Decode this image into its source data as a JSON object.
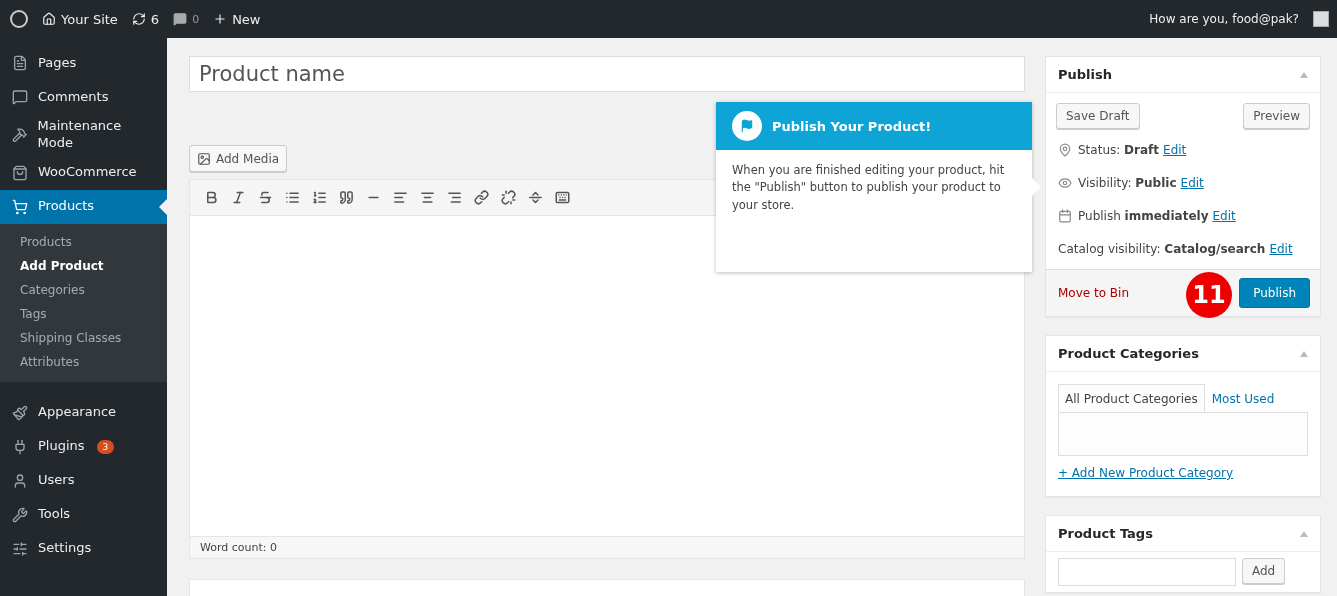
{
  "admin_bar": {
    "site_name": "Your Site",
    "updates_count": "6",
    "comments_count": "0",
    "new_label": "New",
    "greeting": "How are you, food@pak?"
  },
  "sidebar": {
    "items": [
      {
        "label": "Pages",
        "selected": false
      },
      {
        "label": "Comments",
        "selected": false
      },
      {
        "label": "Maintenance Mode",
        "selected": false
      },
      {
        "label": "WooCommerce",
        "selected": false
      },
      {
        "label": "Products",
        "selected": true,
        "children": [
          {
            "label": "Products",
            "selected": false
          },
          {
            "label": "Add Product",
            "selected": true
          },
          {
            "label": "Categories",
            "selected": false
          },
          {
            "label": "Tags",
            "selected": false
          },
          {
            "label": "Shipping Classes",
            "selected": false
          },
          {
            "label": "Attributes",
            "selected": false
          }
        ]
      },
      {
        "label": "Appearance",
        "selected": false
      },
      {
        "label": "Plugins",
        "selected": false,
        "badge": "3"
      },
      {
        "label": "Users",
        "selected": false
      },
      {
        "label": "Tools",
        "selected": false
      },
      {
        "label": "Settings",
        "selected": false
      }
    ]
  },
  "editor": {
    "title_placeholder": "Product name",
    "add_media": "Add Media",
    "word_count": "Word count: 0"
  },
  "tooltip": {
    "title": "Publish Your Product!",
    "body": "When you are finished editing your product, hit the \"Publish\" button to publish your product to your store."
  },
  "publish_box": {
    "title": "Publish",
    "save_draft": "Save Draft",
    "preview": "Preview",
    "meta": [
      {
        "text": "Status: **Draft**",
        "link": "Edit"
      },
      {
        "text": "Visibility: **Public**",
        "link": "Edit"
      },
      {
        "text": "Publish **immediately**",
        "link": "Edit"
      },
      {
        "text": "Catalog visibility: **Catalog/search**",
        "link": "Edit"
      }
    ],
    "move_to_bin": "Move to Bin",
    "step_badge": "11",
    "publish": "Publish"
  },
  "categories_box": {
    "title": "Product Categories",
    "tabs": [
      {
        "label": "All Product Categories",
        "selected": true
      },
      {
        "label": "Most Used",
        "selected": false
      }
    ],
    "add_link": "+ Add New Product Category"
  },
  "tags_box": {
    "title": "Product Tags",
    "add_button": "Add"
  }
}
